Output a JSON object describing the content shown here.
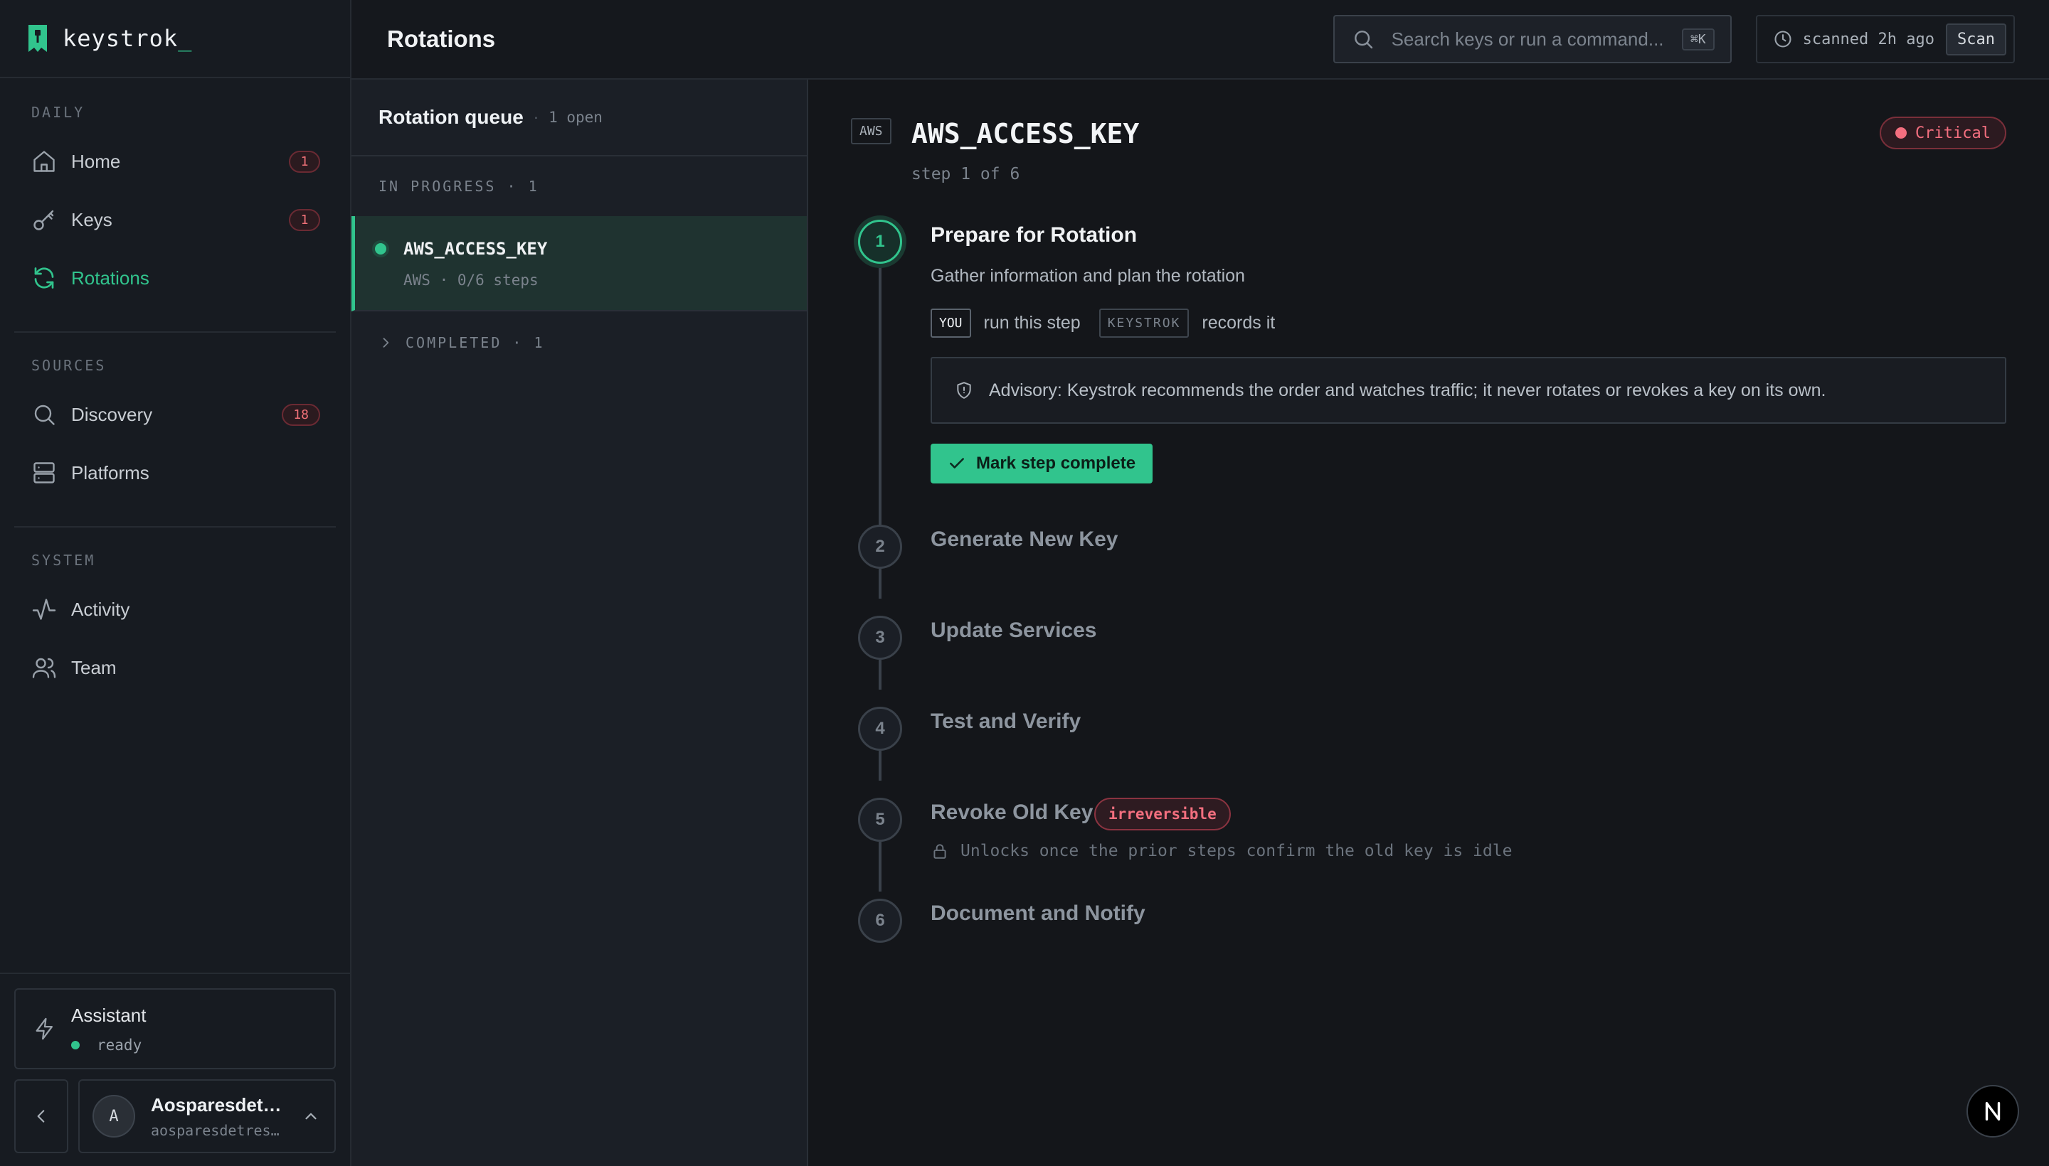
{
  "brand": {
    "name": "keystrok",
    "cursor": "_"
  },
  "sidebar": {
    "sections": [
      {
        "heading": "DAILY",
        "items": [
          {
            "label": "Home",
            "icon": "home-icon",
            "badge": "1"
          },
          {
            "label": "Keys",
            "icon": "key-icon",
            "badge": "1"
          },
          {
            "label": "Rotations",
            "icon": "refresh-icon",
            "active": true
          }
        ]
      },
      {
        "heading": "SOURCES",
        "items": [
          {
            "label": "Discovery",
            "icon": "search-icon",
            "badge": "18"
          },
          {
            "label": "Platforms",
            "icon": "server-icon"
          }
        ]
      },
      {
        "heading": "SYSTEM",
        "items": [
          {
            "label": "Activity",
            "icon": "activity-icon"
          },
          {
            "label": "Team",
            "icon": "users-icon"
          }
        ]
      }
    ],
    "assistant": {
      "title": "Assistant",
      "status": "ready"
    },
    "user": {
      "initial": "A",
      "name": "Aosparesdet…",
      "handle": "aosparesdetres…"
    }
  },
  "header": {
    "title": "Rotations",
    "search_placeholder": "Search keys or run a command...",
    "search_shortcut": "⌘K",
    "scanned": "scanned 2h ago",
    "scan_label": "Scan"
  },
  "queue": {
    "title": "Rotation queue",
    "sep": "·",
    "open": "1 open",
    "in_progress_label": "IN PROGRESS · 1",
    "item": {
      "name": "AWS_ACCESS_KEY",
      "meta": "AWS · 0/6 steps"
    },
    "completed_label": "COMPLETED · 1"
  },
  "detail": {
    "provider": "AWS",
    "key_name": "AWS_ACCESS_KEY",
    "step_progress": "step 1 of 6",
    "severity": "Critical",
    "colors": {
      "accent": "#31c48d",
      "danger": "#f36f7f"
    },
    "steps": [
      {
        "number": "1",
        "title": "Prepare for Rotation",
        "current": true
      },
      {
        "number": "2",
        "title": "Generate New Key"
      },
      {
        "number": "3",
        "title": "Update Services"
      },
      {
        "number": "4",
        "title": "Test and Verify"
      },
      {
        "number": "5",
        "title": "Revoke Old Key",
        "badge": "irreversible",
        "note": "Unlocks once the prior steps confirm the old key is idle"
      },
      {
        "number": "6",
        "title": "Document and Notify"
      }
    ],
    "current_step": {
      "description": "Gather information and plan the rotation",
      "you_tag": "YOU",
      "you_text": "run this step",
      "system_tag": "KEYSTROK",
      "system_text": "records it",
      "advisory": "Advisory: Keystrok recommends the order and watches traffic; it never rotates or revokes a key on its own.",
      "complete_button": "Mark step complete"
    }
  },
  "fab_label": "N"
}
